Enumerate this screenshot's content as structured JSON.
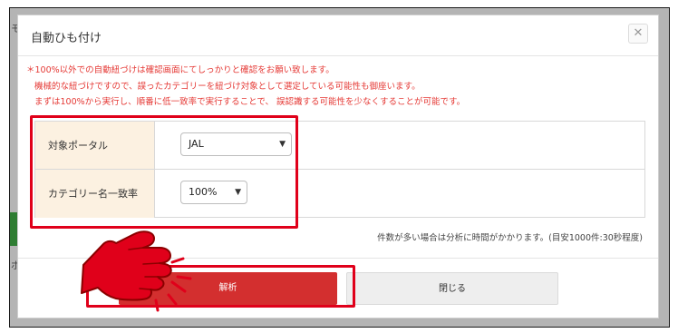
{
  "background": {
    "left_char_top": "モ",
    "left_char_bottom": "ボ"
  },
  "modal": {
    "title": "自動ひも付け",
    "close_icon": "close-icon"
  },
  "notes": {
    "line1": "＊100%以外での自動紐づけは確認画面にてしっかりと確認をお願い致します。",
    "line2": "機械的な紐づけですので、誤ったカテゴリーを紐づけ対象として選定している可能性も御座います。",
    "line3": "まずは100%から実行し、順番に低一致率で実行することで、 誤認識する可能性を少なくすることが可能です。"
  },
  "settings": {
    "portal_label": "対象ポータル",
    "portal_value": "JAL",
    "match_label": "カテゴリー名一致率",
    "match_value": "100%"
  },
  "hint": "件数が多い場合は分析に時間がかかります。(目安1000件:30秒程度)",
  "buttons": {
    "analyze": "解析",
    "close": "閉じる"
  },
  "colors": {
    "accent_red": "#d32f2f",
    "highlight_red": "#e0001a",
    "note_red": "#e53935",
    "label_bg": "#fcf1e1"
  },
  "icons": {
    "dropdown": "chevron-down-icon",
    "annotation": "pointing-hand-icon"
  }
}
